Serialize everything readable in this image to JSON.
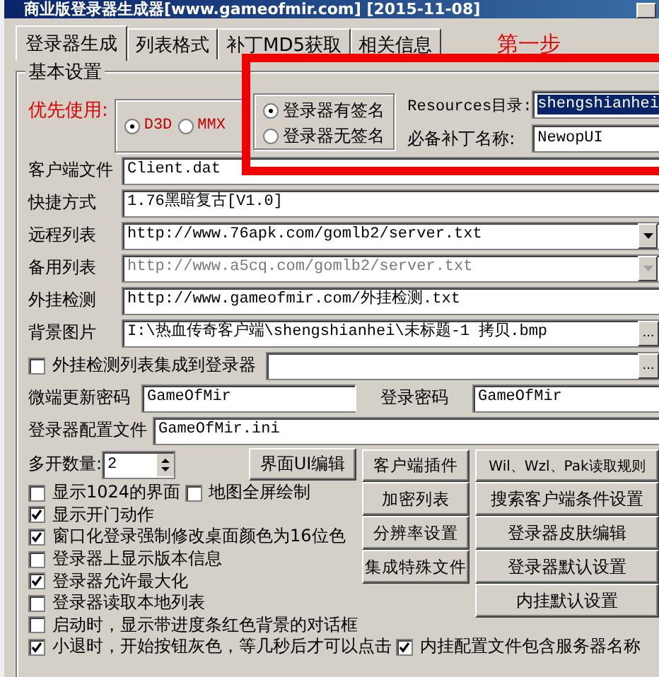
{
  "window": {
    "title": "商业版登录器生成器[www.gameofmir.com] [2015-11-08]"
  },
  "tabs": [
    {
      "label": "登录器生成",
      "selected": true
    },
    {
      "label": "列表格式",
      "selected": false
    },
    {
      "label": "补丁MD5获取",
      "selected": false
    },
    {
      "label": "相关信息",
      "selected": false
    }
  ],
  "step_label": "第一步",
  "group_title": "基本设置",
  "priority": {
    "label": "优先使用:",
    "options": [
      {
        "label": "D3D",
        "selected": true
      },
      {
        "label": "MMX",
        "selected": false
      }
    ]
  },
  "signature": {
    "options": [
      {
        "label": "登录器有签名",
        "selected": true
      },
      {
        "label": "登录器无签名",
        "selected": false
      }
    ]
  },
  "resources": {
    "label": "Resources目录:",
    "value": "shengshianhei"
  },
  "patch": {
    "label": "必备补丁名称:",
    "value": "NewopUI"
  },
  "fields": [
    {
      "label": "客户端文件",
      "value": "Client.dat",
      "kind": "text"
    },
    {
      "label": "快捷方式",
      "value": "1.76黑暗复古[V1.0]",
      "kind": "text"
    },
    {
      "label": "远程列表",
      "value": "http://www.76apk.com/gomlb2/server.txt",
      "kind": "combo",
      "disabled": false
    },
    {
      "label": "备用列表",
      "value": "http://www.a5cq.com/gomlb2/server.txt",
      "kind": "combo",
      "disabled": true
    },
    {
      "label": "外挂检测",
      "value": "http://www.gameofmir.com/外挂检测.txt",
      "kind": "text"
    },
    {
      "label": "背景图片",
      "value": "I:\\热血传奇客户端\\shengshianhei\\未标题-1 拷贝.bmp",
      "kind": "browse",
      "button": "..."
    }
  ],
  "plugin_list": {
    "label": "外挂检测列表集成到登录器",
    "checked": false,
    "button": "..."
  },
  "update_password": {
    "label": "微端更新密码",
    "value": "GameOfMir"
  },
  "login_password": {
    "label": "登录密码",
    "value": "GameOfMir"
  },
  "config_file": {
    "label": "登录器配置文件",
    "value": "GameOfMir.ini"
  },
  "multi_open": {
    "label": "多开数量:",
    "value": "2"
  },
  "ui_button": "界面UI编辑",
  "mid_buttons": [
    "客户端插件",
    "加密列表",
    "分辨率设置",
    "集成特殊文件"
  ],
  "right_buttons": [
    "Wil、Wzl、Pak读取规则",
    "搜索客户端条件设置",
    "登录器皮肤编辑",
    "登录器默认设置",
    "内挂默认设置"
  ],
  "options": [
    {
      "items": [
        {
          "label": "显示1024的界面",
          "checked": false
        },
        {
          "label": "地图全屏绘制",
          "checked": false
        }
      ]
    },
    {
      "items": [
        {
          "label": "显示开门动作",
          "checked": true
        }
      ]
    },
    {
      "items": [
        {
          "label": "窗口化登录强制修改桌面颜色为16位色",
          "checked": true
        }
      ]
    },
    {
      "items": [
        {
          "label": "登录器上显示版本信息",
          "checked": false
        }
      ]
    },
    {
      "items": [
        {
          "label": "登录器允许最大化",
          "checked": true
        }
      ]
    },
    {
      "items": [
        {
          "label": "登录器读取本地列表",
          "checked": false
        }
      ]
    },
    {
      "items": [
        {
          "label": "启动时，显示带进度条红色背景的对话框",
          "checked": false
        }
      ]
    }
  ],
  "last_options": [
    {
      "label": "小退时，开始按钮灰色，等几秒后才可以点击",
      "checked": true
    },
    {
      "label": "内挂配置文件包含服务器名称",
      "checked": true
    }
  ]
}
